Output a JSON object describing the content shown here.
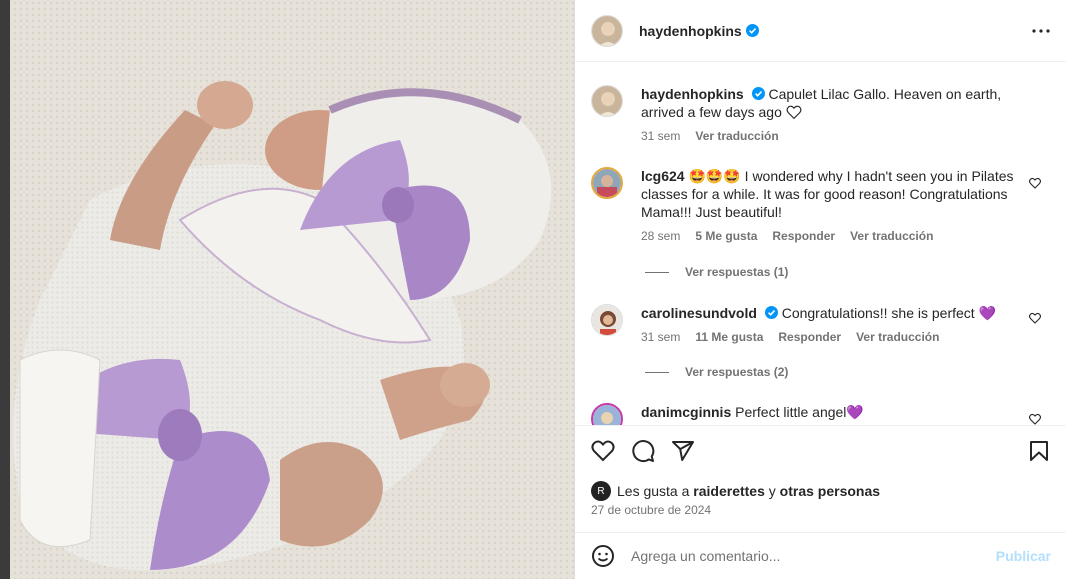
{
  "post": {
    "author": "haydenhopkins",
    "caption_user": "haydenhopkins",
    "caption": "Capulet Lilac Gallo. Heaven on earth, arrived a few days ago",
    "caption_time": "31 sem",
    "caption_translate": "Ver traducción"
  },
  "comments": [
    {
      "user": "lcg624",
      "text": "🤩🤩🤩 I wondered why I hadn't seen you in Pilates classes for a while. It was for good reason! Congratulations Mama!!! Just beautiful!",
      "time": "28 sem",
      "likes": "5 Me gusta",
      "reply": "Responder",
      "translate": "Ver traducción",
      "replies": "Ver respuestas (1)"
    },
    {
      "user": "carolinesundvold",
      "text": "Congratulations!! she is perfect 💜",
      "time": "31 sem",
      "likes": "11 Me gusta",
      "reply": "Responder",
      "translate": "Ver traducción",
      "replies": "Ver respuestas (2)"
    },
    {
      "user": "danimcginnis",
      "text": "Perfect little angel💜"
    }
  ],
  "likes": {
    "prefix": "Les gusta a",
    "user": "raiderettes",
    "middle": "y",
    "others": "otras personas",
    "mini_avatar_letter": "R"
  },
  "date": "27 de octubre de 2024",
  "add_comment": {
    "placeholder": "Agrega un comentario...",
    "post_label": "Publicar"
  },
  "icons": {
    "more": "more-options-icon",
    "like": "heart-icon",
    "comment": "comment-icon",
    "share": "share-icon",
    "save": "bookmark-icon",
    "emoji": "emoji-icon",
    "verified": "verified-badge-icon"
  },
  "colors": {
    "verified": "#0095f6",
    "publish_disabled": "#b2dffc",
    "lilac": "#b89ad3"
  }
}
